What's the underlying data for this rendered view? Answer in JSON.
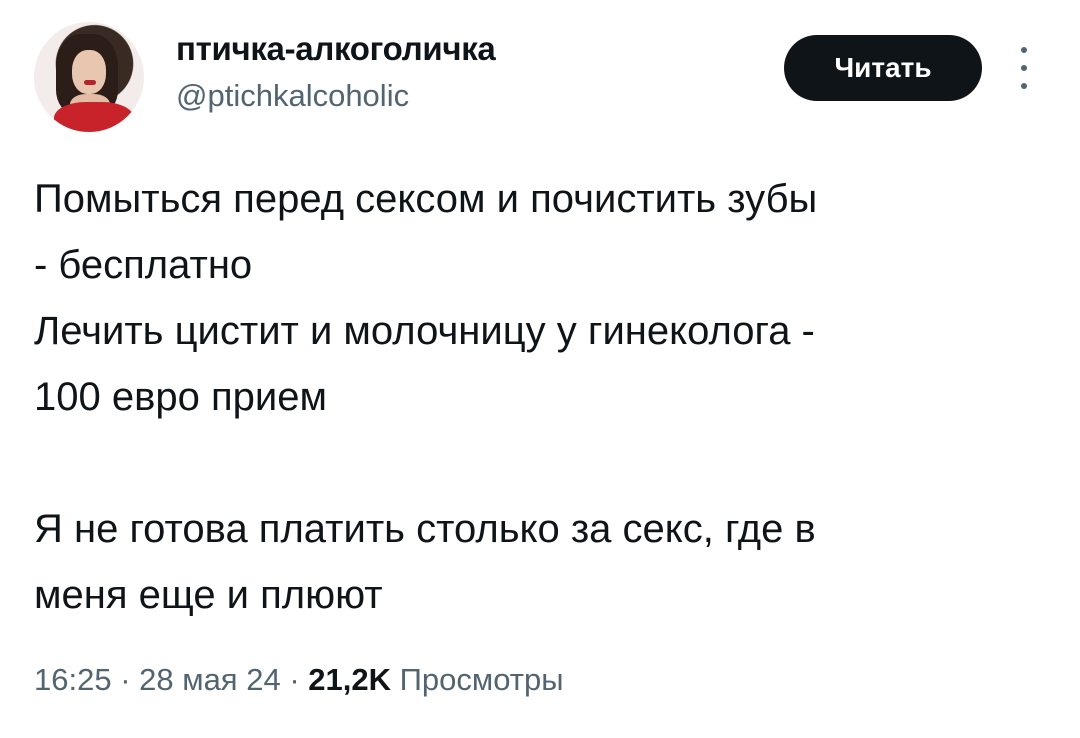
{
  "author": {
    "display_name": "птичка-алкоголичка",
    "handle": "@ptichkalcoholic"
  },
  "actions": {
    "follow_label": "Читать",
    "more_icon": "more-vertical-icon"
  },
  "tweet": {
    "lines": [
      "Помыться перед сексом и почистить зубы",
      "- бесплатно",
      "Лечить цистит и молочницу у гинеколога -",
      "100 евро прием",
      "",
      "Я не готова платить столько за секс, где в",
      "меня еще и плюют"
    ]
  },
  "meta": {
    "time": "16:25",
    "separator": "·",
    "date": "28 мая 24",
    "views_count": "21,2K",
    "views_label": "Просмотры"
  }
}
